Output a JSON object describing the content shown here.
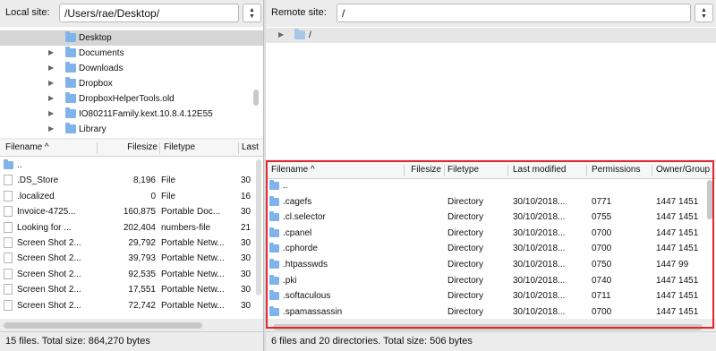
{
  "local": {
    "label": "Local site:",
    "path": "/Users/rae/Desktop/",
    "tree": [
      {
        "name": "Desktop",
        "selected": true,
        "expand": false
      },
      {
        "name": "Documents",
        "selected": false,
        "expand": true
      },
      {
        "name": "Downloads",
        "selected": false,
        "expand": true
      },
      {
        "name": "Dropbox",
        "selected": false,
        "expand": true
      },
      {
        "name": "DropboxHelperTools.old",
        "selected": false,
        "expand": true
      },
      {
        "name": "IO80211Family.kext.10.8.4.12E55",
        "selected": false,
        "expand": true
      },
      {
        "name": "Library",
        "selected": false,
        "expand": true
      }
    ],
    "columns": {
      "filename": "Filename",
      "filesize": "Filesize",
      "filetype": "Filetype",
      "last": "Last"
    },
    "files": [
      {
        "name": "..",
        "size": "",
        "type": "",
        "last": "",
        "dir": true
      },
      {
        "name": ".DS_Store",
        "size": "8,196",
        "type": "File",
        "last": "30",
        "dir": false
      },
      {
        "name": ".localized",
        "size": "0",
        "type": "File",
        "last": "16",
        "dir": false
      },
      {
        "name": "Invoice-4725...",
        "size": "160,875",
        "type": "Portable Doc...",
        "last": "30",
        "dir": false
      },
      {
        "name": "Looking for ...",
        "size": "202,404",
        "type": "numbers-file",
        "last": "21",
        "dir": false
      },
      {
        "name": "Screen Shot 2...",
        "size": "29,792",
        "type": "Portable Netw...",
        "last": "30",
        "dir": false
      },
      {
        "name": "Screen Shot 2...",
        "size": "39,793",
        "type": "Portable Netw...",
        "last": "30",
        "dir": false
      },
      {
        "name": "Screen Shot 2...",
        "size": "92,535",
        "type": "Portable Netw...",
        "last": "30",
        "dir": false
      },
      {
        "name": "Screen Shot 2...",
        "size": "17,551",
        "type": "Portable Netw...",
        "last": "30",
        "dir": false
      },
      {
        "name": "Screen Shot 2...",
        "size": "72,742",
        "type": "Portable Netw...",
        "last": "30",
        "dir": false
      }
    ],
    "status": "15 files. Total size: 864,270 bytes"
  },
  "remote": {
    "label": "Remote site:",
    "path": "/",
    "tree_root": "/",
    "columns": {
      "filename": "Filename",
      "filesize": "Filesize",
      "filetype": "Filetype",
      "modified": "Last modified",
      "permissions": "Permissions",
      "owner": "Owner/Group"
    },
    "files": [
      {
        "name": "..",
        "type": "",
        "modified": "",
        "perm": "",
        "owner": ""
      },
      {
        "name": ".cagefs",
        "type": "Directory",
        "modified": "30/10/2018...",
        "perm": "0771",
        "owner": "1447 1451"
      },
      {
        "name": ".cl.selector",
        "type": "Directory",
        "modified": "30/10/2018...",
        "perm": "0755",
        "owner": "1447 1451"
      },
      {
        "name": ".cpanel",
        "type": "Directory",
        "modified": "30/10/2018...",
        "perm": "0700",
        "owner": "1447 1451"
      },
      {
        "name": ".cphorde",
        "type": "Directory",
        "modified": "30/10/2018...",
        "perm": "0700",
        "owner": "1447 1451"
      },
      {
        "name": ".htpasswds",
        "type": "Directory",
        "modified": "30/10/2018...",
        "perm": "0750",
        "owner": "1447 99"
      },
      {
        "name": ".pki",
        "type": "Directory",
        "modified": "30/10/2018...",
        "perm": "0740",
        "owner": "1447 1451"
      },
      {
        "name": ".softaculous",
        "type": "Directory",
        "modified": "30/10/2018...",
        "perm": "0711",
        "owner": "1447 1451"
      },
      {
        "name": ".spamassassin",
        "type": "Directory",
        "modified": "30/10/2018...",
        "perm": "0700",
        "owner": "1447 1451"
      }
    ],
    "status": "6 files and 20 directories. Total size: 506 bytes"
  },
  "colors": {
    "highlight_frame": "#e0282e",
    "folder": "#7fb3ea",
    "selection": "#d5d5d5"
  }
}
